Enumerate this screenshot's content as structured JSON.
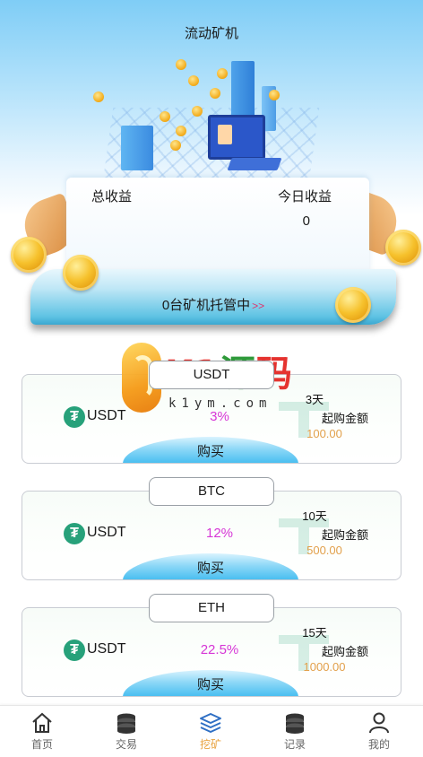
{
  "page": {
    "title": "流动矿机"
  },
  "summary": {
    "total_label": "总收益",
    "today_label": "今日收益",
    "today_value": "0",
    "hosting_text": "0台矿机托管中",
    "hosting_arrows": ">>"
  },
  "watermark": {
    "brand_k1": "K1",
    "brand_yuan": "源",
    "brand_ma": "码",
    "site": "k1ym.com"
  },
  "products": [
    {
      "tag": "USDT",
      "coin": "USDT",
      "rate": "3%",
      "days": "3天",
      "min_label": "起购金额",
      "min_value": "100.00",
      "buy_label": "购买"
    },
    {
      "tag": "BTC",
      "coin": "USDT",
      "rate": "12%",
      "days": "10天",
      "min_label": "起购金额",
      "min_value": "500.00",
      "buy_label": "购买"
    },
    {
      "tag": "ETH",
      "coin": "USDT",
      "rate": "22.5%",
      "days": "15天",
      "min_label": "起购金额",
      "min_value": "1000.00",
      "buy_label": "购买"
    }
  ],
  "nav": {
    "items": [
      {
        "label": "首页",
        "icon": "home-icon"
      },
      {
        "label": "交易",
        "icon": "coin-stack-icon"
      },
      {
        "label": "挖矿",
        "icon": "layers-icon",
        "active": true
      },
      {
        "label": "记录",
        "icon": "coin-stack-icon"
      },
      {
        "label": "我的",
        "icon": "user-icon"
      }
    ]
  },
  "colors": {
    "rate": "#d636d6",
    "min_value": "#e2a04b",
    "nav_active": "#e8a13d",
    "tether_green": "#27a17a"
  }
}
